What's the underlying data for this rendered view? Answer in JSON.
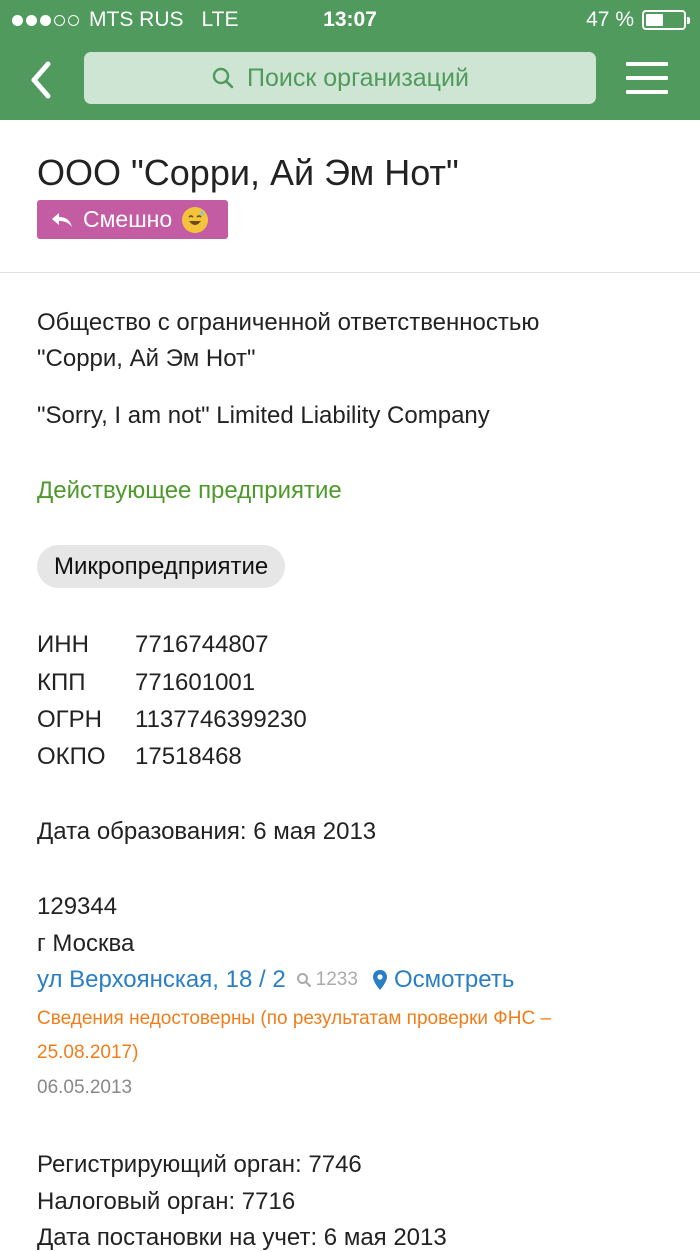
{
  "status_bar": {
    "carrier": "MTS RUS",
    "network": "LTE",
    "time": "13:07",
    "battery": "47 %",
    "battery_level": 0.47
  },
  "header": {
    "search_placeholder": "Поиск организаций",
    "accent_color": "#4f9a5c"
  },
  "company": {
    "short_name": "ООО \"Сорри, Ай Эм Нот\"",
    "tag_label": "Смешно",
    "full_name_line1": "Общество с ограниченной ответственностью",
    "full_name_line2": "\"Сорри, Ай Эм Нот\"",
    "english_name": "\"Sorry, I am not\" Limited Liability Company",
    "status": "Действующее предприятие",
    "category": "Микропредприятие",
    "codes": [
      {
        "label": "ИНН",
        "value": "7716744807"
      },
      {
        "label": "КПП",
        "value": "771601001"
      },
      {
        "label": "ОГРН",
        "value": "1137746399230"
      },
      {
        "label": "ОКПО",
        "value": "17518468"
      }
    ],
    "founded": "Дата образования: 6 мая 2013",
    "address": {
      "postcode": "129344",
      "city": "г Москва",
      "street": "ул Верхоянская, 18 / 2",
      "search_count": "1233",
      "view_label": "Осмотреть",
      "warning_line1": "Сведения недостоверны (по результатам проверки ФНС –",
      "warning_line2": "25.08.2017)",
      "date": "06.05.2013"
    },
    "registering_body": "Регистрирующий орган: 7746",
    "tax_body": "Налоговый орган: 7716",
    "registration_date": "Дата постановки на учет: 6 мая 2013"
  }
}
